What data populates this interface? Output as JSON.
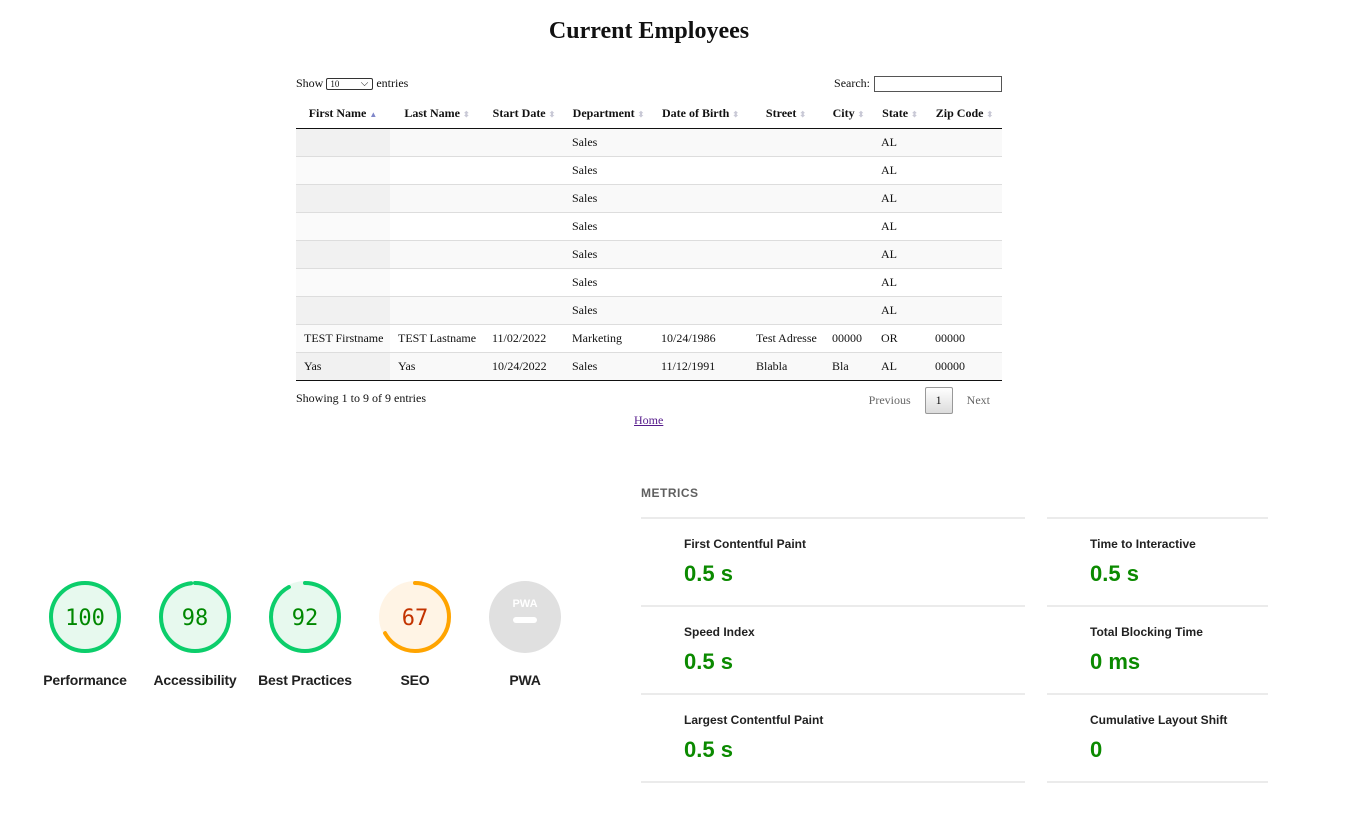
{
  "page": {
    "title": "Current Employees",
    "home_link": "Home"
  },
  "datatable": {
    "show_label": "Show",
    "entries_label": "entries",
    "length_value": "10",
    "search_label": "Search:",
    "search_value": "",
    "columns": [
      "First Name",
      "Last Name",
      "Start Date",
      "Department",
      "Date of Birth",
      "Street",
      "City",
      "State",
      "Zip Code"
    ],
    "sorted_column": "First Name",
    "rows": [
      [
        "",
        "",
        "",
        "Sales",
        "",
        "",
        "",
        "AL",
        ""
      ],
      [
        "",
        "",
        "",
        "Sales",
        "",
        "",
        "",
        "AL",
        ""
      ],
      [
        "",
        "",
        "",
        "Sales",
        "",
        "",
        "",
        "AL",
        ""
      ],
      [
        "",
        "",
        "",
        "Sales",
        "",
        "",
        "",
        "AL",
        ""
      ],
      [
        "",
        "",
        "",
        "Sales",
        "",
        "",
        "",
        "AL",
        ""
      ],
      [
        "",
        "",
        "",
        "Sales",
        "",
        "",
        "",
        "AL",
        ""
      ],
      [
        "",
        "",
        "",
        "Sales",
        "",
        "",
        "",
        "AL",
        ""
      ],
      [
        "TEST Firstname",
        "TEST Lastname",
        "11/02/2022",
        "Marketing",
        "10/24/1986",
        "Test Adresse",
        "00000",
        "OR",
        "00000"
      ],
      [
        "Yas",
        "Yas",
        "10/24/2022",
        "Sales",
        "11/12/1991",
        "Blabla",
        "Bla",
        "AL",
        "00000"
      ]
    ],
    "info": "Showing 1 to 9 of 9 entries",
    "pagination": {
      "previous": "Previous",
      "current": "1",
      "next": "Next"
    }
  },
  "lighthouse": {
    "scores": [
      {
        "label": "Performance",
        "value": "100",
        "fraction": 1.0,
        "color": "#0cce6b",
        "bg": "#e7f9ee",
        "text_color": "#008800"
      },
      {
        "label": "Accessibility",
        "value": "98",
        "fraction": 0.98,
        "color": "#0cce6b",
        "bg": "#e7f9ee",
        "text_color": "#008800"
      },
      {
        "label": "Best Practices",
        "value": "92",
        "fraction": 0.92,
        "color": "#0cce6b",
        "bg": "#e7f9ee",
        "text_color": "#008800"
      },
      {
        "label": "SEO",
        "value": "67",
        "fraction": 0.67,
        "color": "#ffa400",
        "bg": "#fff4e5",
        "text_color": "#c33300"
      },
      {
        "label": "PWA",
        "value": "PWA",
        "fraction": 0,
        "color": "#cccccc",
        "bg": "#e0e0e0",
        "text_color": "#ffffff"
      }
    ],
    "metrics_header": "METRICS",
    "metrics": [
      {
        "title": "First Contentful Paint",
        "value": "0.5 s"
      },
      {
        "title": "Time to Interactive",
        "value": "0.5 s"
      },
      {
        "title": "Speed Index",
        "value": "0.5 s"
      },
      {
        "title": "Total Blocking Time",
        "value": "0 ms"
      },
      {
        "title": "Largest Contentful Paint",
        "value": "0.5 s"
      },
      {
        "title": "Cumulative Layout Shift",
        "value": "0"
      }
    ]
  }
}
